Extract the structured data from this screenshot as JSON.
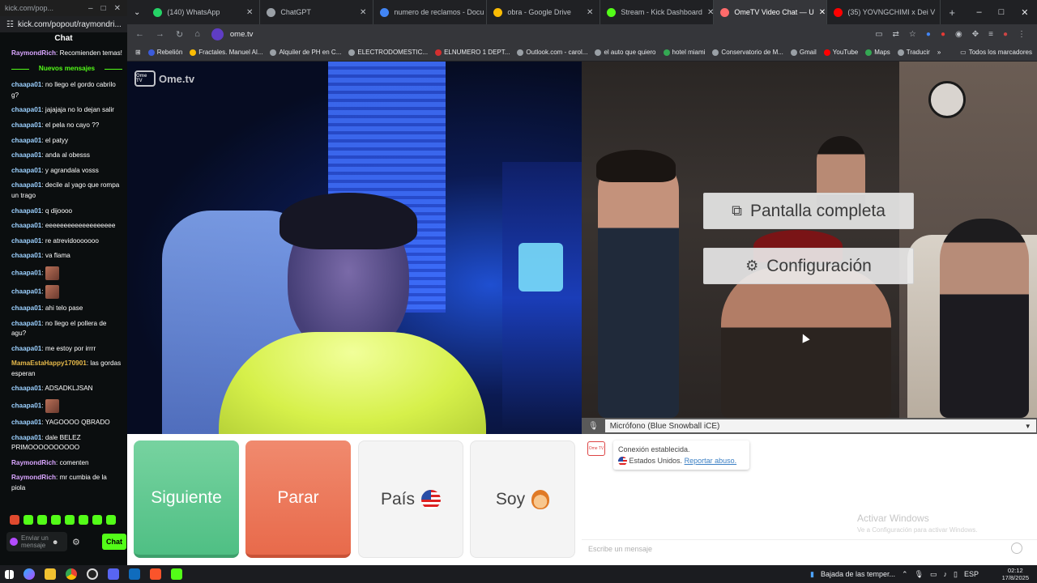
{
  "chat_popout": {
    "url_title": "kick.com/pop...",
    "url": "kick.com/popout/raymondri...",
    "header": "Chat",
    "new_messages_label": "Nuevos mensajes",
    "messages": [
      {
        "user": "RaymondRich",
        "text": ": Recomienden temas!",
        "color": "purple"
      },
      {
        "user": "chaapa01",
        "text": ": no llego el gordo cabrilo g?"
      },
      {
        "user": "chaapa01",
        "text": ": jajajaja no lo dejan salir"
      },
      {
        "user": "chaapa01",
        "text": ": el pela no cayo ??"
      },
      {
        "user": "chaapa01",
        "text": ": el patyy"
      },
      {
        "user": "chaapa01",
        "text": ": anda al obesss"
      },
      {
        "user": "chaapa01",
        "text": ": y agrandala vosss"
      },
      {
        "user": "chaapa01",
        "text": ": decile al yago que rompa un trago"
      },
      {
        "user": "chaapa01",
        "text": ": q dijoooo"
      },
      {
        "user": "chaapa01",
        "text": ": eeeeeeeeeeeeeeeeeee"
      },
      {
        "user": "chaapa01",
        "text": ": re atrevidooooooo"
      },
      {
        "user": "chaapa01",
        "text": ": va flama"
      },
      {
        "user": "chaapa01",
        "text": ":",
        "emote": true
      },
      {
        "user": "chaapa01",
        "text": ":",
        "emote": true
      },
      {
        "user": "chaapa01",
        "text": ": ahi telo pase"
      },
      {
        "user": "chaapa01",
        "text": ": no llego el pollera de agu?"
      },
      {
        "user": "chaapa01",
        "text": ": me estoy por irrrr"
      },
      {
        "user": "MamaEstaHappy170901",
        "text": ": las gordas esperan",
        "color": "green"
      },
      {
        "user": "chaapa01",
        "text": ": ADSADKLJSAN"
      },
      {
        "user": "chaapa01",
        "text": ":",
        "emote": true
      },
      {
        "user": "chaapa01",
        "text": ": YAGOOOO QBRADO"
      },
      {
        "user": "chaapa01",
        "text": ": dale BELEZ PRIMOOOOOOOOOO"
      },
      {
        "user": "RaymondRich",
        "text": ": comenten",
        "color": "purple"
      },
      {
        "user": "RaymondRich",
        "text": ": mr cumbia de la piola",
        "color": "purple"
      }
    ],
    "input_placeholder": "Enviar un mensaje",
    "chat_button": "Chat"
  },
  "tabs": [
    {
      "label": "(140) WhatsApp",
      "color": "#25d366"
    },
    {
      "label": "ChatGPT",
      "color": "#9aa0a6"
    },
    {
      "label": "numero de reclamos - Docu",
      "color": "#4285f4"
    },
    {
      "label": "obra - Google Drive",
      "color": "#fbbc04"
    },
    {
      "label": "Stream - Kick Dashboard",
      "color": "#53fc18"
    },
    {
      "label": "OmeTV Video Chat — U",
      "color": "#ff6b6b",
      "active": true
    },
    {
      "label": "(35) YOVNGCHIMI x Dei V",
      "color": "#ff0000"
    }
  ],
  "omnibox": {
    "url": "ome.tv"
  },
  "bookmarks": [
    {
      "label": "Rebelión",
      "color": "#3b5bdb"
    },
    {
      "label": "Fractales. Manuel Al...",
      "color": "#fbbc04"
    },
    {
      "label": "Alquiler de PH en C...",
      "color": "#9aa0a6"
    },
    {
      "label": "ELECTRODOMESTIC...",
      "color": "#9aa0a6"
    },
    {
      "label": "ELNUMERO 1 DEPT...",
      "color": "#d32f2f"
    },
    {
      "label": "Outlook.com - carol...",
      "color": "#9aa0a6"
    },
    {
      "label": "el auto que quiero",
      "color": "#9aa0a6"
    },
    {
      "label": "hotel miami",
      "color": "#34a853"
    },
    {
      "label": "Conservatorio de M...",
      "color": "#9aa0a6"
    },
    {
      "label": "Gmail",
      "color": "#9aa0a6"
    },
    {
      "label": "YouTube",
      "color": "#ff0000"
    },
    {
      "label": "Maps",
      "color": "#34a853"
    },
    {
      "label": "Traducir",
      "color": "#9aa0a6"
    }
  ],
  "bookmarks_all": "Todos los marcadores",
  "ometv": {
    "logo_text": "Ome.tv",
    "logo_box": "Ome TV",
    "overlay": {
      "fullscreen": "Pantalla completa",
      "config": "Configuración"
    },
    "mic_select": "Micrófono (Blue Snowball iCE)",
    "buttons": {
      "next": "Siguiente",
      "stop": "Parar",
      "country": "País",
      "gender": "Soy"
    },
    "system_message": {
      "line1": "Conexión establecida.",
      "country": "Estados Unidos.",
      "report": "Reportar abuso."
    },
    "input_placeholder": "Escribe un mensaje"
  },
  "windows_watermark": {
    "title": "Activar Windows",
    "subtitle": "Ve a Configuración para activar Windows."
  },
  "taskbar": {
    "weather": "Bajada de las temper...",
    "lang": "ESP",
    "time": "02:12",
    "date": "17/8/2025"
  }
}
